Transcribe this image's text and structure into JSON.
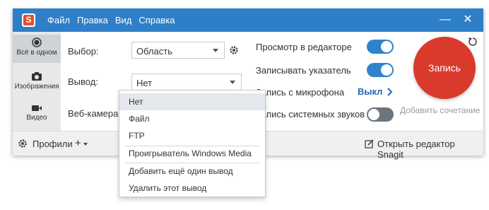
{
  "app": {
    "logo_letter": "S"
  },
  "menu": [
    "Файл",
    "Правка",
    "Вид",
    "Справка"
  ],
  "window_controls": {
    "minimize": "—",
    "close": "✕"
  },
  "left_nav": [
    {
      "label": "Всё в одном",
      "icon": "all-in-one-icon",
      "active": true
    },
    {
      "label": "Изображения",
      "icon": "camera-icon",
      "active": false
    },
    {
      "label": "Видео",
      "icon": "video-icon",
      "active": false
    }
  ],
  "settings": {
    "selection_label": "Выбор:",
    "selection_value": "Область",
    "output_label": "Вывод:",
    "output_value": "Нет",
    "webcam_label": "Веб-камера:"
  },
  "options": [
    {
      "label": "Просмотр в редакторе",
      "state": "on"
    },
    {
      "label": "Записывать указатель",
      "state": "on"
    },
    {
      "label": "Запись с микрофона",
      "value": "Выкл"
    },
    {
      "label": "Запись системных звуков",
      "state": "off"
    }
  ],
  "record": {
    "label": "Запись",
    "hint": "Добавить сочетание"
  },
  "bottom": {
    "profiles": "Профили",
    "add": "+",
    "open_editor": "Открыть редактор Snagit"
  },
  "dropdown": {
    "items": [
      "Нет",
      "Файл",
      "FTP",
      "Проигрыватель Windows Media",
      "Добавить ещё один вывод",
      "Удалить этот вывод"
    ],
    "selected_index": 0
  },
  "colors": {
    "titlebar": "#2e7ec8",
    "record": "#d93a2b",
    "toggle_on": "#2f83cc",
    "accent_link": "#2468b1"
  }
}
